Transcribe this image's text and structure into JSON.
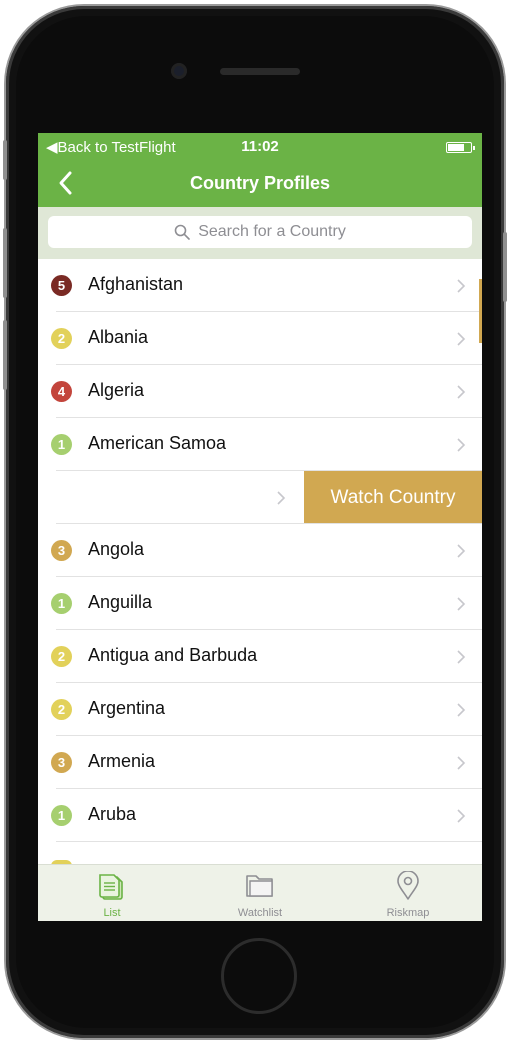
{
  "status_bar": {
    "back_label": "Back to TestFlight",
    "time": "11:02"
  },
  "nav": {
    "title": "Country Profiles"
  },
  "search": {
    "placeholder": "Search for a Country"
  },
  "colors": {
    "green": "#6bb346",
    "gold": "#d1a851",
    "risk1": "#a6cf6f",
    "risk2": "#e2d15a",
    "risk3": "#d1a851",
    "risk4": "#c3453c",
    "risk5": "#7a2a24"
  },
  "countries": [
    {
      "name": "Afghanistan",
      "risk": "5"
    },
    {
      "name": "Albania",
      "risk": "2"
    },
    {
      "name": "Algeria",
      "risk": "4"
    },
    {
      "name": "American Samoa",
      "risk": "1"
    },
    {
      "name": "Angola",
      "risk": "3"
    },
    {
      "name": "Anguilla",
      "risk": "1"
    },
    {
      "name": "Antigua and Barbuda",
      "risk": "2"
    },
    {
      "name": "Argentina",
      "risk": "2"
    },
    {
      "name": "Armenia",
      "risk": "3"
    },
    {
      "name": "Aruba",
      "risk": "1"
    }
  ],
  "swipe_action": {
    "label": "Watch Country"
  },
  "tabs": [
    {
      "label": "List",
      "icon": "list-document-icon",
      "active": true
    },
    {
      "label": "Watchlist",
      "icon": "folder-icon",
      "active": false
    },
    {
      "label": "Riskmap",
      "icon": "map-pin-icon",
      "active": false
    }
  ]
}
